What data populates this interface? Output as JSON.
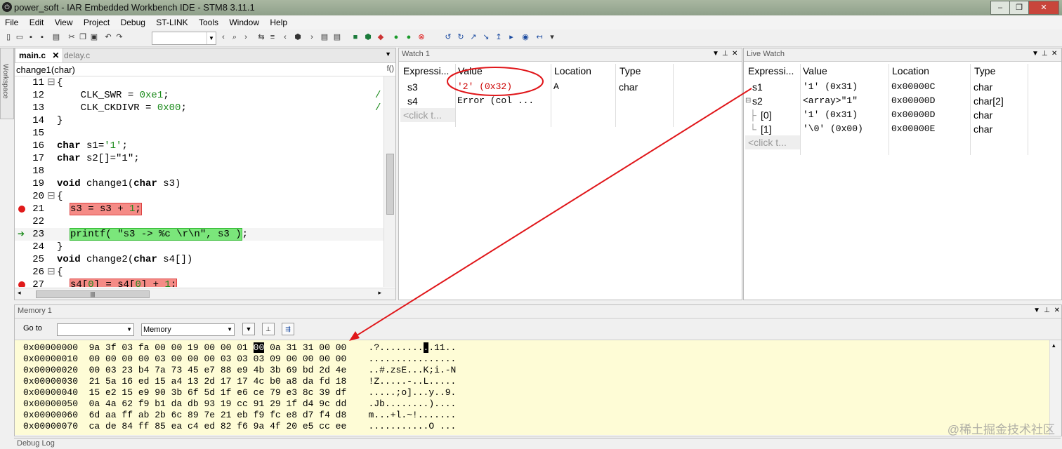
{
  "window": {
    "title": "power_soft - IAR Embedded Workbench IDE - STM8 3.11.1"
  },
  "menu": [
    "File",
    "Edit",
    "View",
    "Project",
    "Debug",
    "ST-LINK",
    "Tools",
    "Window",
    "Help"
  ],
  "workspace_label": "Workspace",
  "editor": {
    "tabs": [
      {
        "label": "main.c",
        "active": true
      },
      {
        "label": "delay.c",
        "active": false
      }
    ],
    "function": "change1(char)",
    "func_button": "f()",
    "lines": [
      {
        "n": "11",
        "text": "{"
      },
      {
        "n": "12",
        "text": "    CLK_SWR = 0xe1;"
      },
      {
        "n": "13",
        "text": "    CLK_CKDIVR = 0x00;"
      },
      {
        "n": "14",
        "text": "}"
      },
      {
        "n": "15",
        "text": ""
      },
      {
        "n": "16",
        "text": "char s1='1';"
      },
      {
        "n": "17",
        "text": "char s2[]=\"1\";"
      },
      {
        "n": "18",
        "text": ""
      },
      {
        "n": "19",
        "text": "void change1(char s3)"
      },
      {
        "n": "20",
        "text": "{"
      },
      {
        "n": "21",
        "text": "s3 = s3 + 1;",
        "breakpoint": true
      },
      {
        "n": "22",
        "text": ""
      },
      {
        "n": "23",
        "text": "printf( \"s3 -> %c \\r\\n\", s3 );",
        "current": true
      },
      {
        "n": "24",
        "text": "}"
      },
      {
        "n": "25",
        "text": "void change2(char s4[])"
      },
      {
        "n": "26",
        "text": "{"
      },
      {
        "n": "27",
        "text": "s4[0] = s4[0] + 1;",
        "breakpoint": true
      }
    ],
    "comment_marks": [
      "/",
      "/"
    ]
  },
  "watch1": {
    "title": "Watch 1",
    "columns": [
      "Expressi...",
      "Value",
      "Location",
      "Type"
    ],
    "rows": [
      {
        "expr": "s3",
        "value": "'2' (0x32)",
        "location": "A",
        "type": "char"
      },
      {
        "expr": "s4",
        "value": "Error (col ...",
        "location": "",
        "type": ""
      }
    ],
    "add_placeholder": "<click t..."
  },
  "livewatch": {
    "title": "Live Watch",
    "columns": [
      "Expressi...",
      "Value",
      "Location",
      "Type"
    ],
    "rows": [
      {
        "expr": "s1",
        "value": "'1' (0x31)",
        "location": "0x00000C",
        "type": "char"
      },
      {
        "expr": "s2",
        "value": "<array>\"1\"",
        "location": "0x00000D",
        "type": "char[2]"
      },
      {
        "expr": "[0]",
        "value": "'1' (0x31)",
        "location": "0x00000D",
        "type": "char"
      },
      {
        "expr": "[1]",
        "value": "'\\0' (0x00)",
        "location": "0x00000E",
        "type": "char"
      }
    ],
    "add_placeholder": "<click t..."
  },
  "memory": {
    "title": "Memory 1",
    "goto_label": "Go to",
    "memory_select": "Memory",
    "rows": [
      {
        "addr": "0x00000000",
        "bytes_a": "9a 3f 03 fa 00 00 19 00 00 01 ",
        "sel": "00",
        "bytes_b": " 0a 31 31 00 00",
        "ascii": ".?........",
        "ascii_sel": ".",
        "ascii_b": ".11.."
      },
      {
        "addr": "0x00000010",
        "bytes_a": "00 00 00 00 03 00 00 00 03 03 03 09 00 00 00 00",
        "sel": "",
        "bytes_b": "",
        "ascii": "................",
        "ascii_sel": "",
        "ascii_b": ""
      },
      {
        "addr": "0x00000020",
        "bytes_a": "00 03 23 b4 7a 73 45 e7 88 e9 4b 3b 69 bd 2d 4e",
        "sel": "",
        "bytes_b": "",
        "ascii": "..#.zsE...K;i.-N",
        "ascii_sel": "",
        "ascii_b": ""
      },
      {
        "addr": "0x00000030",
        "bytes_a": "21 5a 16 ed 15 a4 13 2d 17 17 4c b0 a8 da fd 18",
        "sel": "",
        "bytes_b": "",
        "ascii": "!Z.....-..L.....",
        "ascii_sel": "",
        "ascii_b": ""
      },
      {
        "addr": "0x00000040",
        "bytes_a": "15 e2 15 e9 90 3b 6f 5d 1f e6 ce 79 e3 8c 39 df",
        "sel": "",
        "bytes_b": "",
        "ascii": ".....;o]...y..9.",
        "ascii_sel": "",
        "ascii_b": ""
      },
      {
        "addr": "0x00000050",
        "bytes_a": "0a 4a 62 f9 b1 da db 93 19 cc 91 29 1f d4 9c dd",
        "sel": "",
        "bytes_b": "",
        "ascii": ".Jb........)....",
        "ascii_sel": "",
        "ascii_b": ""
      },
      {
        "addr": "0x00000060",
        "bytes_a": "6d aa ff ab 2b 6c 89 7e 21 eb f9 fc e8 d7 f4 d8",
        "sel": "",
        "bytes_b": "",
        "ascii": "m...+l.~!.......",
        "ascii_sel": "",
        "ascii_b": ""
      },
      {
        "addr": "0x00000070",
        "bytes_a": "ca de 84 ff 85 ea c4 ed 82 f6 9a 4f 20 e5 cc ee",
        "sel": "",
        "bytes_b": "",
        "ascii": "...........O ...",
        "ascii_sel": "",
        "ascii_b": ""
      }
    ]
  },
  "debuglog": {
    "title": "Debug Log"
  },
  "watermark": "@稀土掘金技术社区"
}
